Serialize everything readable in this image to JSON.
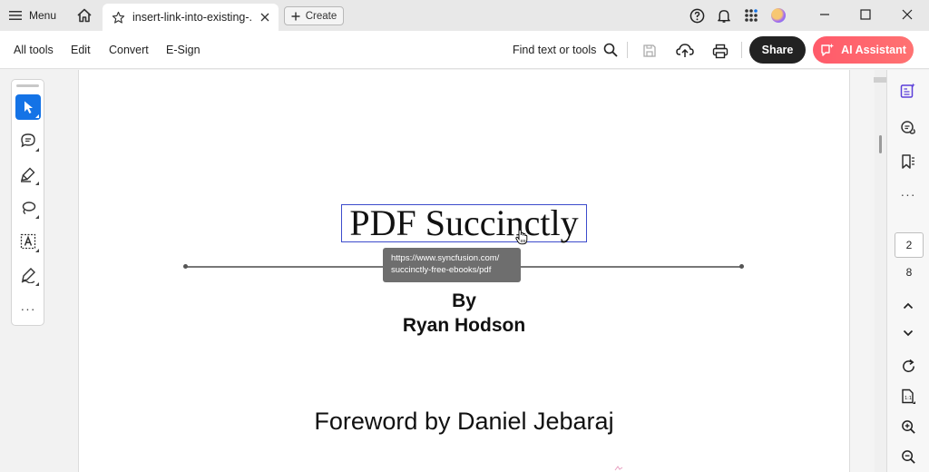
{
  "titlebar": {
    "menu_label": "Menu",
    "tab_title": "insert-link-into-existing-...",
    "create_label": "Create"
  },
  "toolbar": {
    "menus": [
      "All tools",
      "Edit",
      "Convert",
      "E-Sign"
    ],
    "find_label": "Find text or tools",
    "share_label": "Share",
    "ai_label": "AI Assistant"
  },
  "colors": {
    "accent_blue": "#1473e6",
    "share_bg": "#222222",
    "ai_gradient_start": "#ff5a6a",
    "link_border": "#3d4ccc",
    "tooltip_bg": "#6e6e6e"
  },
  "document": {
    "title": "PDF Succinctly",
    "tooltip_line1": "https://www.syncfusion.com/",
    "tooltip_line2": "succinctly-free-ebooks/pdf",
    "by": "By",
    "author": "Ryan Hodson",
    "foreword": "Foreword by Daniel Jebaraj"
  },
  "left_tools": [
    {
      "icon": "select-arrow-icon",
      "active": true
    },
    {
      "icon": "comment-icon",
      "active": false
    },
    {
      "icon": "highlight-pen-icon",
      "active": false
    },
    {
      "icon": "lasso-draw-icon",
      "active": false
    },
    {
      "icon": "text-recognition-icon",
      "active": false
    },
    {
      "icon": "sign-pen-icon",
      "active": false
    },
    {
      "icon": "more-icon",
      "active": false
    }
  ],
  "right_rail": {
    "current_page": "2",
    "total_pages": "8"
  }
}
